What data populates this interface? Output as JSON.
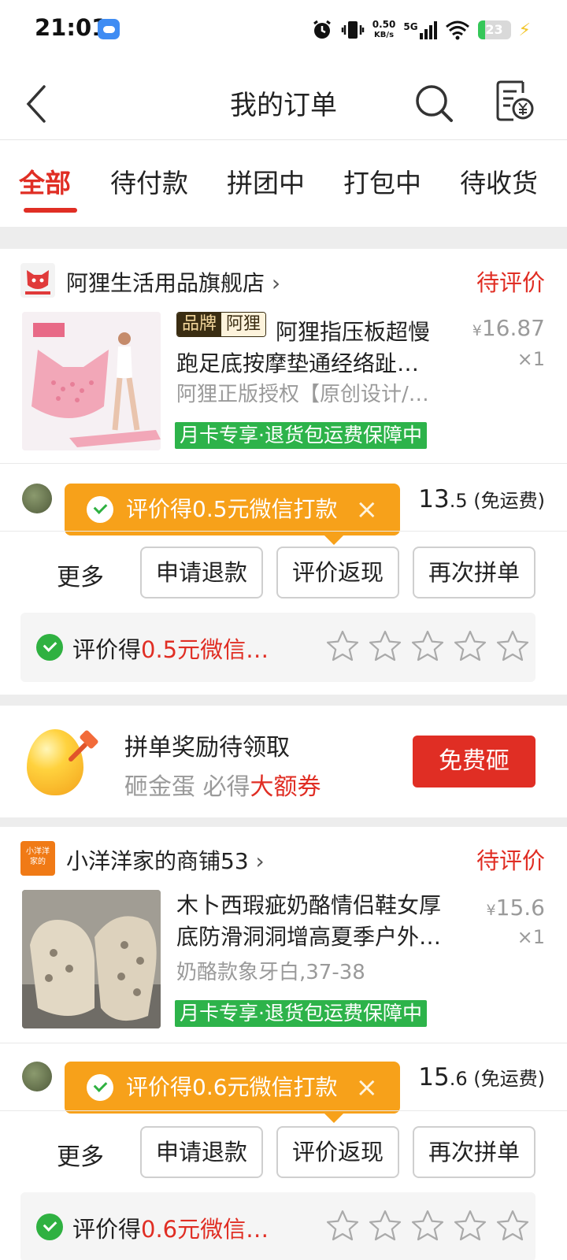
{
  "status_bar": {
    "time": "21:01",
    "speed_value": "0.50",
    "speed_unit": "KB/s",
    "network": "5G",
    "battery": "23",
    "battery_level": 0.23
  },
  "header": {
    "title": "我的订单",
    "back_icon": "back-arrow-icon",
    "search_icon": "search-icon",
    "bill_icon": "bill-yen-icon"
  },
  "tabs": [
    {
      "label": "全部",
      "active": true
    },
    {
      "label": "待付款"
    },
    {
      "label": "拼团中"
    },
    {
      "label": "打包中"
    },
    {
      "label": "待收货"
    }
  ],
  "orders": [
    {
      "store_name": "阿狸生活用品旗舰店",
      "status": "待评价",
      "brand_tag": "品牌",
      "brand_name": "阿狸",
      "title_line1": "阿狸指压板超慢",
      "title_line2": "跑足底按摩垫通经络趾…",
      "spec": "阿狸正版授权【原创设计/…",
      "price_symbol": "¥",
      "price_int": "16",
      "price_dec": ".87",
      "qty": "×1",
      "promo": "月卡专享·退货包运费保障中",
      "total_int": "13",
      "total_dec": ".5",
      "total_note": " (免运费)",
      "tooltip": "评价得0.5元微信打款",
      "tooltip_close": "×",
      "review_prefix": "评价得",
      "review_reward": "0.5元微信…",
      "more": "更多",
      "buttons": [
        "申请退款",
        "评价返现",
        "再次拼单"
      ]
    },
    {
      "store_name": "小洋洋家的商铺53",
      "store_logo_text_1": "小洋洋",
      "store_logo_text_2": "家的",
      "status": "待评价",
      "title_line1": "木卜西瑕疵奶酪情侣鞋女厚",
      "title_line2": "底防滑洞洞增高夏季户外…",
      "spec": "奶酪款象牙白,37-38",
      "price_symbol": "¥",
      "price_int": "15",
      "price_dec": ".6",
      "qty": "×1",
      "promo": "月卡专享·退货包运费保障中",
      "total_int": "15",
      "total_dec": ".6",
      "total_note": " (免运费)",
      "tooltip": "评价得0.6元微信打款",
      "tooltip_close": "×",
      "review_prefix": "评价得",
      "review_reward": "0.6元微信…",
      "more": "更多",
      "buttons": [
        "申请退款",
        "评价返现",
        "再次拼单"
      ]
    }
  ],
  "reward_banner": {
    "title": "拼单奖励待领取",
    "sub_prefix": "砸金蛋 必得",
    "sub_highlight": "大额券",
    "button": "免费砸"
  },
  "colors": {
    "accent": "#e02e24",
    "promo_green": "#2db34a",
    "tooltip_orange": "#f7a11a",
    "wechat_green": "#2fb141"
  }
}
